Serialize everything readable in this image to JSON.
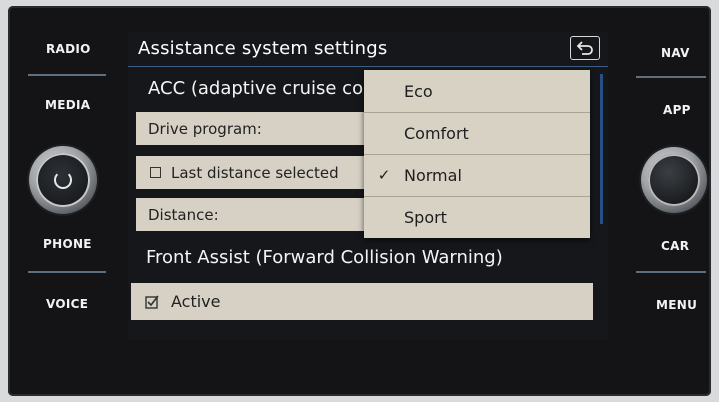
{
  "side_buttons": {
    "radio": "RADIO",
    "media": "MEDIA",
    "phone": "PHONE",
    "voice": "VOICE",
    "nav": "NAV",
    "app": "APP",
    "car": "CAR",
    "menu": "MENU"
  },
  "screen": {
    "title": "Assistance system settings",
    "acc_heading": "ACC (adaptive cruise co",
    "drive_program_label": "Drive program:",
    "last_distance_label": "Last distance selected",
    "last_distance_checked": false,
    "distance_label": "Distance:",
    "front_assist_heading": "Front Assist (Forward Collision Warning)",
    "active_label": "Active",
    "active_checked": true
  },
  "dropdown": {
    "items": [
      {
        "label": "Eco",
        "selected": false
      },
      {
        "label": "Comfort",
        "selected": false
      },
      {
        "label": "Normal",
        "selected": true
      },
      {
        "label": "Sport",
        "selected": false
      }
    ],
    "check_glyph": "✓"
  },
  "colors": {
    "accent_line": "#3e5f86",
    "row_bg": "#d7d1c5",
    "screen_bg": "#15171b"
  }
}
